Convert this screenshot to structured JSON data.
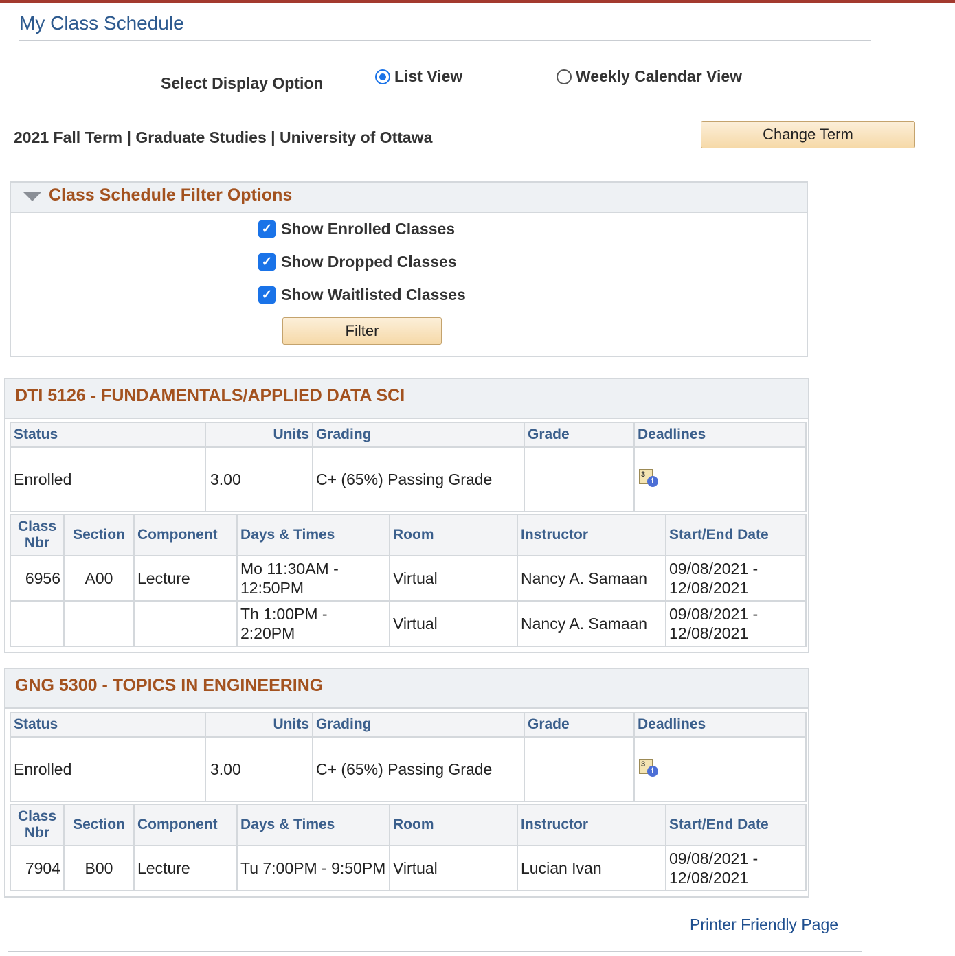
{
  "page": {
    "title": "My Class Schedule"
  },
  "display_options": {
    "label": "Select Display Option",
    "options": [
      {
        "label": "List View",
        "selected": true
      },
      {
        "label": "Weekly Calendar View",
        "selected": false
      }
    ]
  },
  "term": {
    "text": "2021 Fall Term | Graduate Studies | University of Ottawa",
    "change_button": "Change Term"
  },
  "filter": {
    "title": "Class Schedule Filter Options",
    "checkboxes": [
      {
        "label": "Show Enrolled Classes",
        "checked": true
      },
      {
        "label": "Show Dropped Classes",
        "checked": true
      },
      {
        "label": "Show Waitlisted Classes",
        "checked": true
      }
    ],
    "button": "Filter"
  },
  "summary_headers": {
    "status": "Status",
    "units": "Units",
    "grading": "Grading",
    "grade": "Grade",
    "deadlines": "Deadlines"
  },
  "section_headers": {
    "class_nbr": "Class Nbr",
    "section": "Section",
    "component": "Component",
    "days_times": "Days & Times",
    "room": "Room",
    "instructor": "Instructor",
    "start_end": "Start/End Date"
  },
  "courses": [
    {
      "title": "DTI 5126 - FUNDAMENTALS/APPLIED DATA SCI",
      "status": "Enrolled",
      "units": "3.00",
      "grading": "C+ (65%) Passing Grade",
      "grade": "",
      "deadline_icon": "calendar-info-icon",
      "sections": [
        {
          "class_nbr": "6956",
          "section": "A00",
          "component": "Lecture",
          "days_times": "Mo 11:30AM - 12:50PM",
          "room": "Virtual",
          "instructor": "Nancy A. Samaan",
          "dates": "09/08/2021 - 12/08/2021"
        },
        {
          "class_nbr": "",
          "section": "",
          "component": "",
          "days_times": "Th 1:00PM - 2:20PM",
          "room": "Virtual",
          "instructor": "Nancy A. Samaan",
          "dates": "09/08/2021 - 12/08/2021"
        }
      ]
    },
    {
      "title": "GNG 5300 - TOPICS IN ENGINEERING",
      "status": "Enrolled",
      "units": "3.00",
      "grading": "C+ (65%) Passing Grade",
      "grade": "",
      "deadline_icon": "calendar-info-icon",
      "sections": [
        {
          "class_nbr": "7904",
          "section": "B00",
          "component": "Lecture",
          "days_times": "Tu 7:00PM - 9:50PM",
          "room": "Virtual",
          "instructor": "Lucian Ivan",
          "dates": "09/08/2021 - 12/08/2021"
        }
      ]
    }
  ],
  "footer": {
    "printer_link": "Printer Friendly Page"
  },
  "colors": {
    "accent_blue": "#2d5a8f",
    "header_orange": "#a3521f",
    "top_bar": "#a33a2e",
    "button_fill": "#f6d9a8"
  }
}
